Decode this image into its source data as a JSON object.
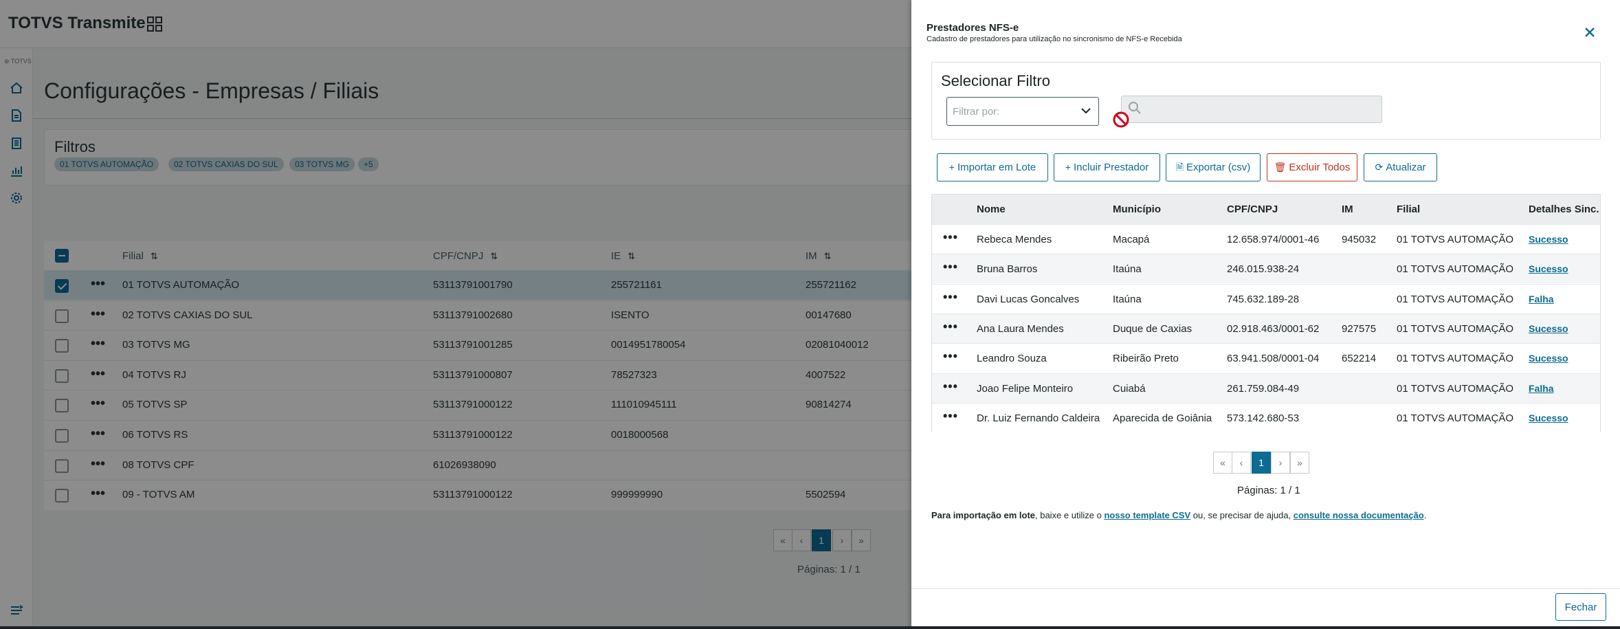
{
  "app": {
    "title": "TOTVS Transmite",
    "sidebar_brand": "⊛ TOTVS",
    "sidebar_icons": [
      "home-icon",
      "document-icon",
      "clipboard-icon",
      "chart-icon",
      "settings-icon"
    ],
    "page_title": "Configurações - Empresas / Filiais",
    "filters": {
      "label": "Filtros",
      "chips": [
        "01 TOTVS AUTOMAÇÃO",
        "02 TOTVS CAXIAS DO SUL",
        "03 TOTVS MG",
        "+5"
      ]
    },
    "table": {
      "headers": {
        "filial": "Filial",
        "cnpj": "CPF/CNPJ",
        "ie": "IE",
        "im": "IM"
      },
      "rows": [
        {
          "filial": "01 TOTVS AUTOMAÇÃO",
          "cnpj": "53113791001790",
          "ie": "255721161",
          "im": "255721162",
          "checked": true
        },
        {
          "filial": "02 TOTVS CAXIAS DO SUL",
          "cnpj": "53113791002680",
          "ie": "ISENTO",
          "im": "00147680",
          "checked": false
        },
        {
          "filial": "03 TOTVS MG",
          "cnpj": "53113791001285",
          "ie": "0014951780054",
          "im": "02081040012",
          "checked": false
        },
        {
          "filial": "04 TOTVS RJ",
          "cnpj": "53113791000807",
          "ie": "78527323",
          "im": "4007522",
          "checked": false
        },
        {
          "filial": "05 TOTVS SP",
          "cnpj": "53113791000122",
          "ie": "111010945111",
          "im": "90814274",
          "checked": false
        },
        {
          "filial": "06 TOTVS RS",
          "cnpj": "53113791000122",
          "ie": "0018000568",
          "im": "",
          "checked": false
        },
        {
          "filial": "08 TOTVS CPF",
          "cnpj": "61026938090",
          "ie": "",
          "im": "",
          "checked": false
        },
        {
          "filial": "09 - TOTVS AM",
          "cnpj": "53113791000122",
          "ie": "999999990",
          "im": "5502594",
          "checked": false
        }
      ]
    },
    "pager": {
      "first": "«",
      "prev": "‹",
      "current": "1",
      "next": "›",
      "last": "»",
      "pages_text": "Páginas: 1 / 1"
    }
  },
  "drawer": {
    "title": "Prestadores NFS-e",
    "subtitle": "Cadastro de prestadores para utilização no sincronismo de NFS-e Recebida",
    "filter": {
      "title": "Selecionar Filtro",
      "select_placeholder": "Filtrar por:",
      "search_value": ""
    },
    "buttons": {
      "import": "Importar em Lote",
      "add": "Incluir Prestador",
      "export": "Exportar (csv)",
      "delete_all": "Excluir Todos",
      "refresh": "Atualizar"
    },
    "table": {
      "headers": {
        "nome": "Nome",
        "municipio": "Município",
        "cnpj": "CPF/CNPJ",
        "im": "IM",
        "filial": "Filial",
        "detalhes": "Detalhes Sinc."
      },
      "rows": [
        {
          "nome": "Rebeca Mendes",
          "municipio": "Macapá",
          "cnpj": "12.658.974/0001-46",
          "im": "945032",
          "filial": "01 TOTVS AUTOMAÇÃO",
          "detalhes": "Sucesso"
        },
        {
          "nome": "Bruna Barros",
          "municipio": "Itaúna",
          "cnpj": "246.015.938-24",
          "im": "",
          "filial": "01 TOTVS AUTOMAÇÃO",
          "detalhes": "Sucesso"
        },
        {
          "nome": "Davi Lucas Goncalves",
          "municipio": "Itaúna",
          "cnpj": "745.632.189-28",
          "im": "",
          "filial": "01 TOTVS AUTOMAÇÃO",
          "detalhes": "Falha"
        },
        {
          "nome": "Ana Laura Mendes",
          "municipio": "Duque de Caxias",
          "cnpj": "02.918.463/0001-62",
          "im": "927575",
          "filial": "01 TOTVS AUTOMAÇÃO",
          "detalhes": "Sucesso"
        },
        {
          "nome": "Leandro Souza",
          "municipio": "Ribeirão Preto",
          "cnpj": "63.941.508/0001-04",
          "im": "652214",
          "filial": "01 TOTVS AUTOMAÇÃO",
          "detalhes": "Sucesso"
        },
        {
          "nome": "Joao Felipe Monteiro",
          "municipio": "Cuiabá",
          "cnpj": "261.759.084-49",
          "im": "",
          "filial": "01 TOTVS AUTOMAÇÃO",
          "detalhes": "Falha"
        },
        {
          "nome": "Dr. Luiz Fernando Caldeira",
          "municipio": "Aparecida de Goiânia",
          "cnpj": "573.142.680-53",
          "im": "",
          "filial": "01 TOTVS AUTOMAÇÃO",
          "detalhes": "Sucesso"
        }
      ]
    },
    "pager": {
      "first": "«",
      "prev": "‹",
      "current": "1",
      "next": "›",
      "last": "»",
      "pages_text": "Páginas: 1 / 1"
    },
    "help": {
      "bold": "Para importação em lote",
      "text1": ", baixe e utilize o ",
      "link1": "nosso template CSV",
      "text2": " ou, se precisar de ajuda, ",
      "link2": "consulte nossa documentação",
      "text3": "."
    },
    "close_button": "Fechar"
  },
  "colors": {
    "accent": "#0c6c94",
    "danger": "#c0341d",
    "overlay": "rgba(0,0,0,0.45)"
  }
}
